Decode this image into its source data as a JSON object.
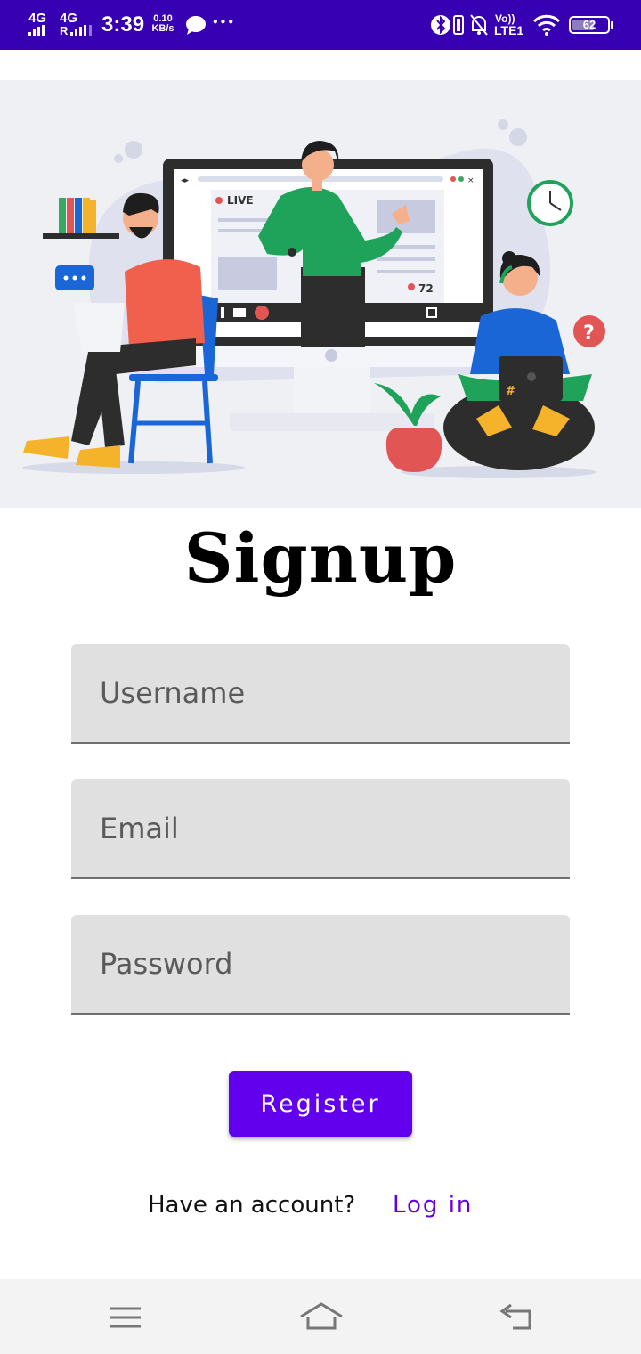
{
  "status_bar": {
    "network1": "4G",
    "network2": "4G",
    "network2_sub": "R",
    "time": "3:39",
    "speed_value": "0.10",
    "speed_unit": "KB/s",
    "more": "•••",
    "volte_top": "Vo))",
    "volte_bottom": "LTE1",
    "battery_level": "62",
    "battery_fraction": 0.62,
    "background_color": "#3700b3"
  },
  "hero": {
    "description_icon": "online-meeting-illustration"
  },
  "form": {
    "title": "Signup",
    "username_placeholder": "Username",
    "email_placeholder": "Email",
    "password_placeholder": "Password",
    "register_label": "Register",
    "accent_color": "#6200ee"
  },
  "footer": {
    "have_account": "Have an account?",
    "login_label": "Log in"
  },
  "nav_bar": {
    "menu_icon": "menu-icon",
    "home_icon": "home-icon",
    "back_icon": "back-icon"
  }
}
